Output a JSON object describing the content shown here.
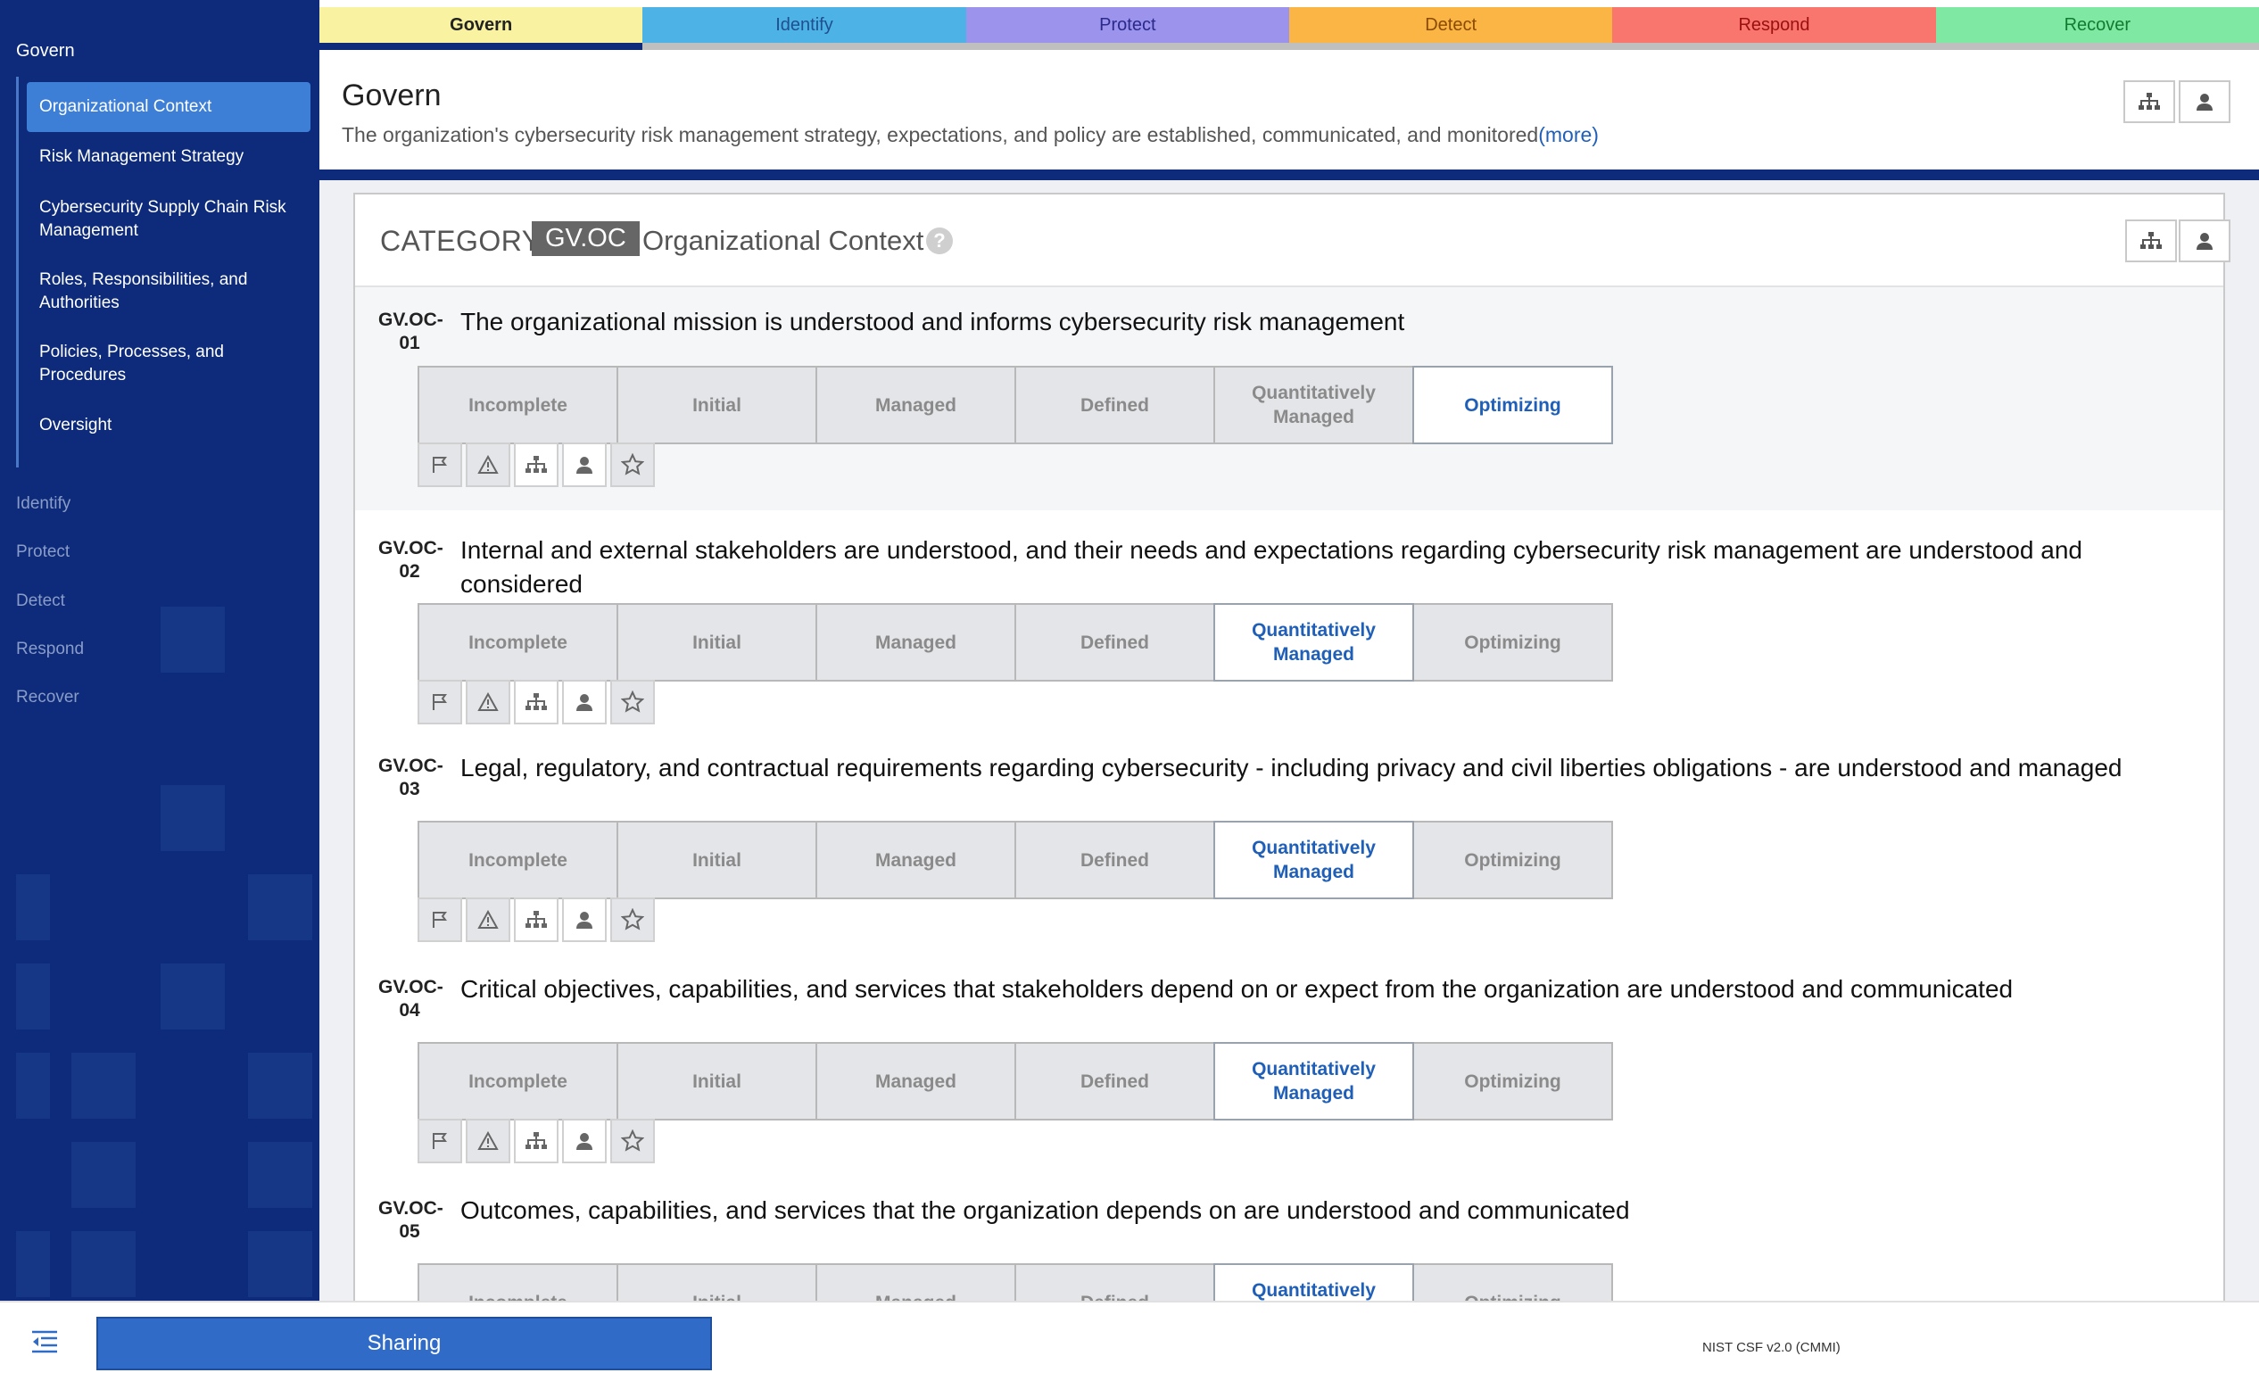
{
  "sidebar": {
    "title": "Govern",
    "sub_items": [
      {
        "label": "Organizational Context",
        "active": true
      },
      {
        "label": "Risk Management Strategy"
      },
      {
        "label": "Cybersecurity Supply Chain Risk Management"
      },
      {
        "label": "Roles, Responsibilities, and Authorities"
      },
      {
        "label": "Policies, Processes, and Procedures"
      },
      {
        "label": "Oversight"
      }
    ],
    "main_items": [
      "Identify",
      "Protect",
      "Detect",
      "Respond",
      "Recover"
    ]
  },
  "tabs": [
    {
      "label": "Govern",
      "bg": "#f9f3a1",
      "color": "#222222",
      "active": true
    },
    {
      "label": "Identify",
      "bg": "#4db3e6",
      "color": "#1f4f8f"
    },
    {
      "label": "Protect",
      "bg": "#9b93ec",
      "color": "#2a2a8a"
    },
    {
      "label": "Detect",
      "bg": "#fbb545",
      "color": "#8a4a00"
    },
    {
      "label": "Respond",
      "bg": "#f8766d",
      "color": "#9b0f0f"
    },
    {
      "label": "Recover",
      "bg": "#7fe9a3",
      "color": "#137a30"
    }
  ],
  "header": {
    "title": "Govern",
    "description": "The organization's cybersecurity risk management strategy, expectations, and policy are established, communicated, and monitored",
    "more": "(more)"
  },
  "category": {
    "label": "CATEGORY",
    "code": "GV.OC",
    "name": "Organizational Context",
    "help": "?"
  },
  "maturity_levels": [
    "Incomplete",
    "Initial",
    "Managed",
    "Defined",
    "Quantitatively Managed",
    "Optimizing"
  ],
  "subcategories": [
    {
      "id_prefix": "GV.OC-",
      "id_num": "01",
      "text": "The organizational mission is understood and informs cybersecurity risk management",
      "selected_level": "Optimizing"
    },
    {
      "id_prefix": "GV.OC-",
      "id_num": "02",
      "text": "Internal and external stakeholders are understood, and their needs and expectations regarding cybersecurity risk management are understood and considered",
      "selected_level": "Quantitatively Managed"
    },
    {
      "id_prefix": "GV.OC-",
      "id_num": "03",
      "text": "Legal, regulatory, and contractual requirements regarding cybersecurity - including privacy and civil liberties obligations - are understood and managed",
      "selected_level": "Quantitatively Managed"
    },
    {
      "id_prefix": "GV.OC-",
      "id_num": "04",
      "text": "Critical objectives, capabilities, and services that stakeholders depend on or expect from the organization are understood and communicated",
      "selected_level": "Quantitatively Managed"
    },
    {
      "id_prefix": "GV.OC-",
      "id_num": "05",
      "text": "Outcomes, capabilities, and services that the organization depends on are understood and communicated",
      "selected_level": "Quantitatively Managed"
    }
  ],
  "tools": [
    "flag-icon",
    "warning-icon",
    "org-chart-icon",
    "person-icon",
    "star-icon"
  ],
  "footer": {
    "sharing": "Sharing",
    "version": "NIST CSF v2.0 (CMMI)"
  },
  "colors": {
    "sidebar_bg": "#0d2b7a",
    "accent": "#1f5fb8",
    "active_sub_item": "#3d7fd6"
  }
}
